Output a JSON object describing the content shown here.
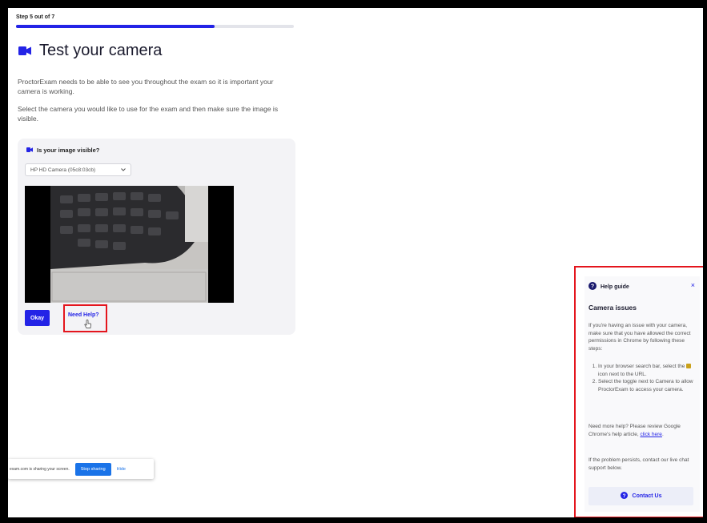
{
  "step": {
    "label": "Step 5 out of 7",
    "progress": 0.714
  },
  "header": {
    "title": "Test your camera"
  },
  "intro": {
    "p1": "ProctorExam needs to be able to see you throughout the exam so it is important your camera is working.",
    "p2": "Select the camera you would like to use for the exam and then make sure the image is visible."
  },
  "camera_card": {
    "heading": "Is your image visible?",
    "selected_camera": "HP HD Camera (05c8:03cb)",
    "okay_label": "Okay",
    "need_help_label": "Need Help?"
  },
  "share_bar": {
    "text": "exam.com is sharing your screen.",
    "stop_label": "Stop sharing",
    "hide_label": "Hide"
  },
  "help_guide": {
    "title": "Help guide",
    "close": "×",
    "subtitle": "Camera issues",
    "intro": "If you're having an issue with your camera, make sure that you have allowed the correct permissions in Chrome by following these steps:",
    "step1_a": "In your browser search bar, select the",
    "step1_b": "icon next to the URL.",
    "step2": "Select the toggle next to Camera to allow ProctorExam to access your camera.",
    "more_a": "Need more help? Please review Google Chrome's help article,",
    "more_link": "click here",
    "more_b": ".",
    "persist": "If the problem persists, contact our live chat support below.",
    "contact_label": "Contact Us"
  },
  "colors": {
    "accent": "#2323e6",
    "highlight": "#e4151d",
    "chrome_blue": "#1a73e8"
  }
}
